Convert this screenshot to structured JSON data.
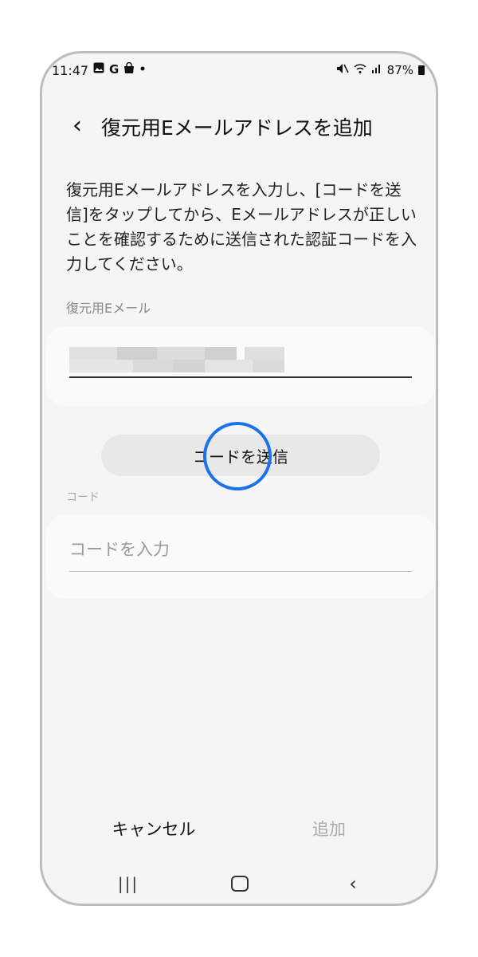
{
  "status_bar": {
    "time": "11:47",
    "left_icons": [
      "gallery-icon",
      "google-icon",
      "shopping-bag-icon",
      "dot-icon"
    ],
    "google_glyph": "G",
    "battery": "87%",
    "right_icons": [
      "mute-icon",
      "wifi-icon",
      "signal-icon",
      "battery-icon"
    ]
  },
  "header": {
    "back_glyph": "‹",
    "title": "復元用Eメールアドレスを追加"
  },
  "description": "復元用Eメールアドレスを入力し、[コードを送信]をタップしてから、Eメールアドレスが正しいことを確認するために送信された認証コードを入力してください。",
  "email_section": {
    "label": "復元用Eメール"
  },
  "send_code_button": {
    "label": "コードを送信"
  },
  "code_section": {
    "label": "コード",
    "placeholder": "コードを入力"
  },
  "bottom_actions": {
    "cancel_label": "キャンセル",
    "add_label": "追加"
  },
  "nav_bar": {
    "recent_glyph": "|||",
    "back_glyph": "‹"
  },
  "colors": {
    "accent_tap": "#1a73e8",
    "background": "#f5f5f5",
    "disabled_text": "#aaaaaa"
  }
}
